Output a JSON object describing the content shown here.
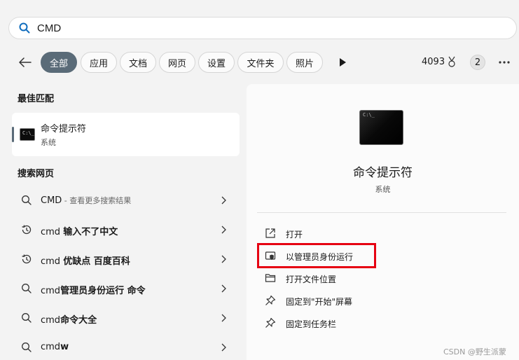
{
  "search": {
    "value": "CMD",
    "icon": "search-icon"
  },
  "filters": {
    "back_icon": "back-arrow-icon",
    "tabs": [
      "全部",
      "应用",
      "文档",
      "网页",
      "设置",
      "文件夹",
      "照片"
    ],
    "active_tab": "全部",
    "play_icon": "play-icon",
    "points": "4093",
    "badge_count": "2",
    "more_icon": "more-icon"
  },
  "best_match": {
    "heading": "最佳匹配",
    "title": "命令提示符",
    "subtitle": "系统"
  },
  "web_search": {
    "heading": "搜索网页",
    "items": [
      {
        "norm": "CMD",
        "bold": "",
        "hint": " - 查看更多搜索结果",
        "icon": "search-icon"
      },
      {
        "norm": "cmd ",
        "bold": "输入不了中文",
        "hint": "",
        "icon": "history-icon"
      },
      {
        "norm": "cmd ",
        "bold": "优缺点 百度百科",
        "hint": "",
        "icon": "history-icon"
      },
      {
        "norm": "cmd",
        "bold": "管理员身份运行 命令",
        "hint": "",
        "icon": "search-icon"
      },
      {
        "norm": "cmd",
        "bold": "命令大全",
        "hint": "",
        "icon": "search-icon"
      },
      {
        "norm": "cmd",
        "bold": "w",
        "hint": "",
        "icon": "search-icon"
      }
    ]
  },
  "detail": {
    "title": "命令提示符",
    "subtitle": "系统",
    "actions": [
      {
        "label": "打开",
        "icon": "open-external-icon"
      },
      {
        "label": "以管理员身份运行",
        "icon": "shield-icon"
      },
      {
        "label": "打开文件位置",
        "icon": "folder-icon"
      },
      {
        "label": "固定到\"开始\"屏幕",
        "icon": "pin-icon"
      },
      {
        "label": "固定到任务栏",
        "icon": "pin-icon"
      }
    ]
  },
  "watermark": "CSDN @野生派蒙",
  "colors": {
    "accent": "#5a6b78",
    "highlight": "#e60012",
    "search_icon": "#0f6cbd"
  }
}
